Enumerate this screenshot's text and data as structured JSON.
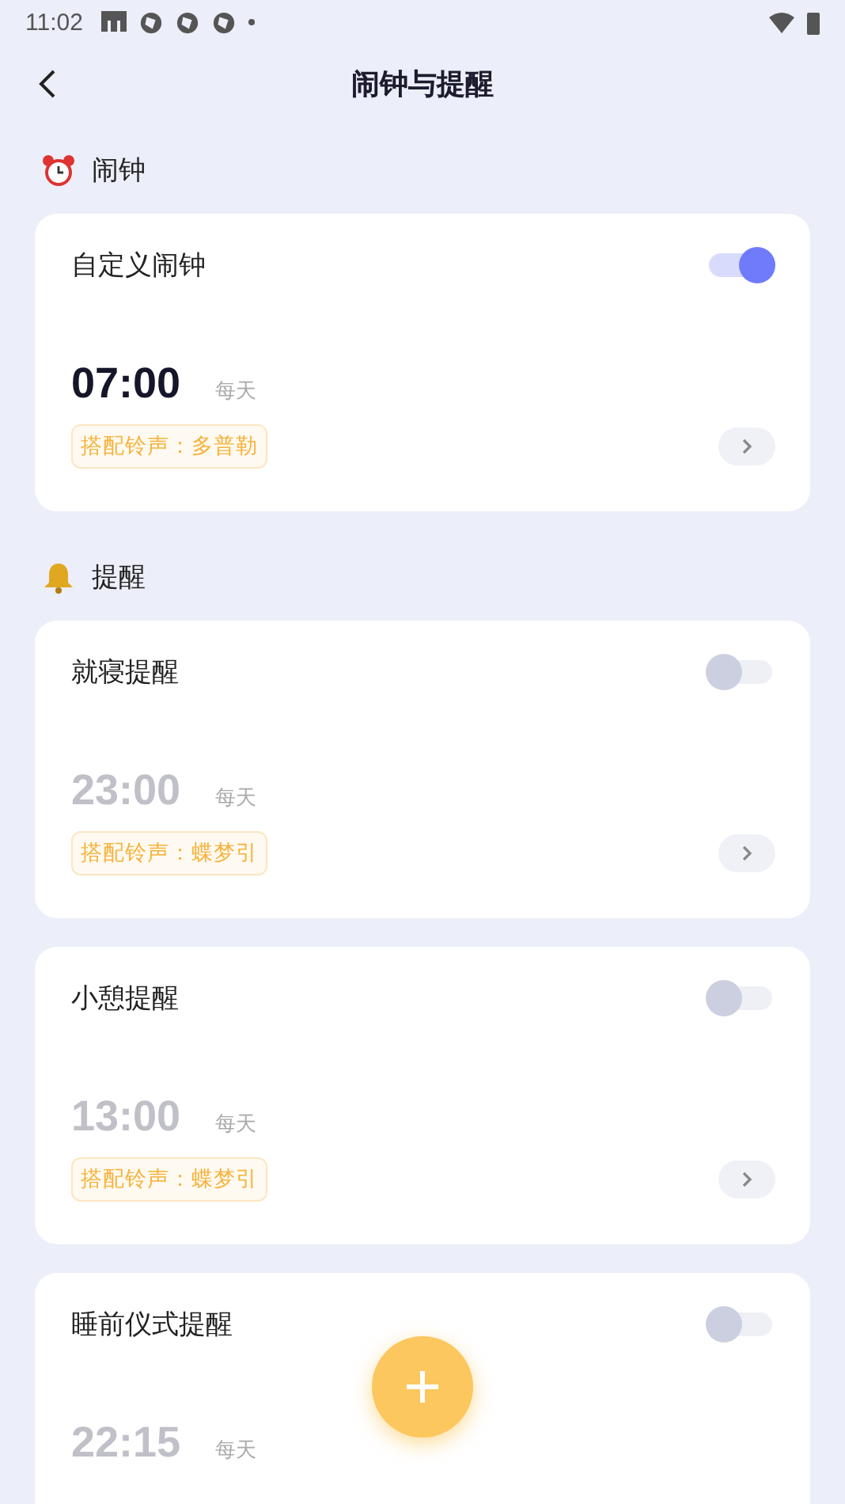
{
  "status_bar": {
    "time": "11:02"
  },
  "header": {
    "title": "闹钟与提醒"
  },
  "sections": [
    {
      "title": "闹钟",
      "items": [
        {
          "title": "自定义闹钟",
          "on": true,
          "time": "07:00",
          "repeat": "每天",
          "ringtone": "搭配铃声：多普勒"
        }
      ]
    },
    {
      "title": "提醒",
      "items": [
        {
          "title": "就寝提醒",
          "on": false,
          "time": "23:00",
          "repeat": "每天",
          "ringtone": "搭配铃声：蝶梦引"
        },
        {
          "title": "小憩提醒",
          "on": false,
          "time": "13:00",
          "repeat": "每天",
          "ringtone": "搭配铃声：蝶梦引"
        },
        {
          "title": "睡前仪式提醒",
          "on": false,
          "time": "22:15",
          "repeat": "每天"
        }
      ]
    }
  ]
}
